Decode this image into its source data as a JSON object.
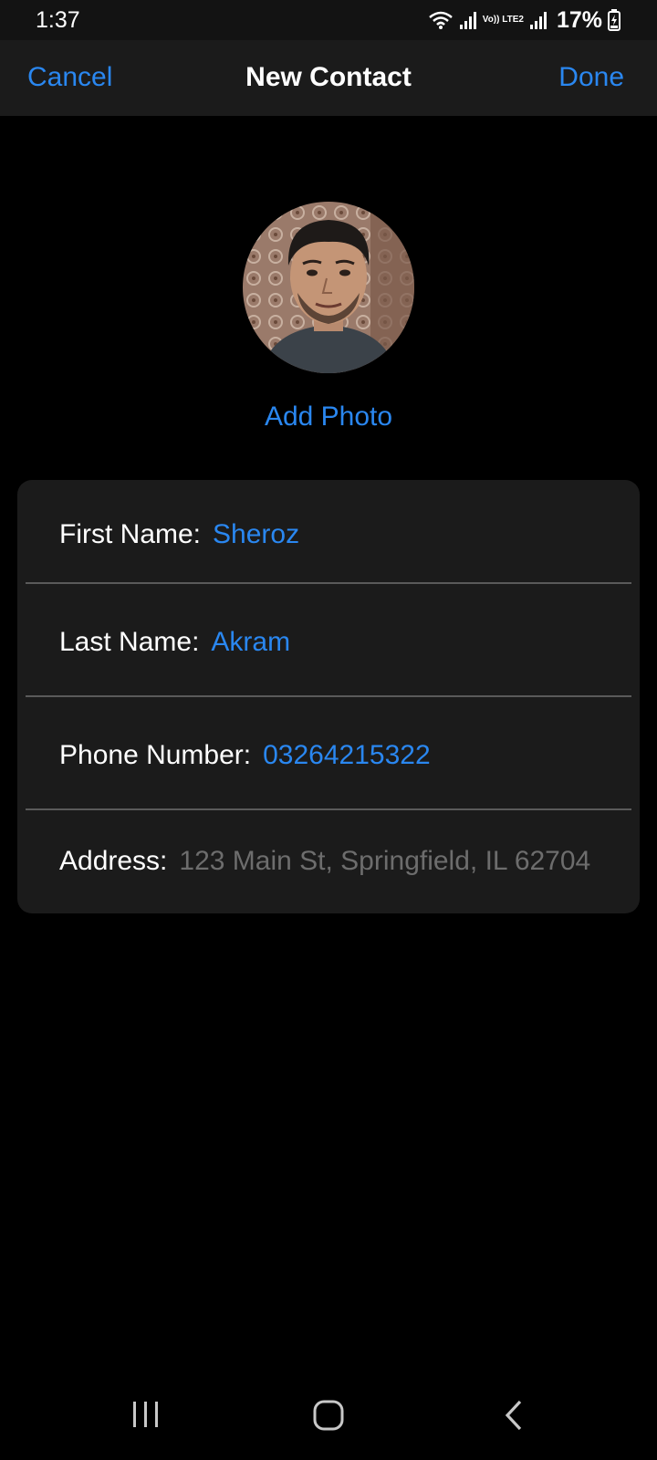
{
  "status_bar": {
    "time": "1:37",
    "battery": "17%",
    "network_label": "Vo)) LTE2",
    "icons": [
      "wifi-icon",
      "signal-icon",
      "signal-icon",
      "battery-charging-icon"
    ]
  },
  "header": {
    "cancel_label": "Cancel",
    "title": "New Contact",
    "done_label": "Done"
  },
  "photo": {
    "add_photo_label": "Add Photo"
  },
  "form": {
    "fields": [
      {
        "label": "First Name:",
        "value": "Sheroz"
      },
      {
        "label": "Last Name:",
        "value": "Akram"
      },
      {
        "label": "Phone Number:",
        "value": "03264215322"
      },
      {
        "label": "Address:",
        "placeholder": "123 Main St, Springfield, IL 62704"
      }
    ]
  },
  "colors": {
    "accent": "#2a87f0",
    "background": "#000000",
    "card": "#1b1b1b",
    "placeholder": "#6d6d6d"
  }
}
